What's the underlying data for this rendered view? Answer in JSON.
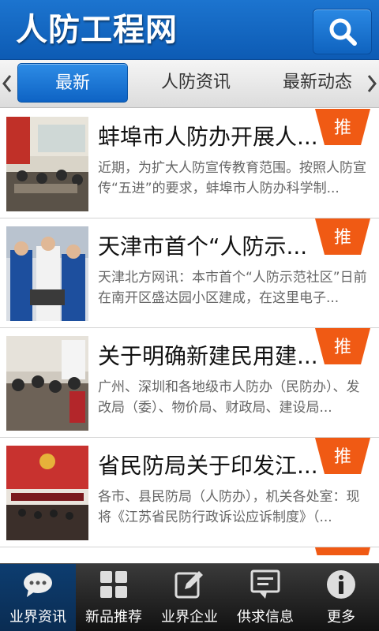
{
  "header": {
    "title": "人防工程网",
    "search_icon": "search-icon"
  },
  "tabs": [
    {
      "label": "最新",
      "active": true
    },
    {
      "label": "人防资讯",
      "active": false
    },
    {
      "label": "最新动态",
      "active": false
    }
  ],
  "news": [
    {
      "title": "蚌埠市人防办开展人...",
      "summary": "近期，为扩大人防宣传教育范围。按照人防宣传“五进”的要求，蚌埠市人防办科学制...",
      "badge": "推"
    },
    {
      "title": "天津市首个“人防示...",
      "summary": "天津北方网讯：本市首个“人防示范社区”日前在南开区盛达园小区建成，在这里电子...",
      "badge": "推"
    },
    {
      "title": "关于明确新建民用建...",
      "summary": "广州、深圳和各地级市人防办（民防办）、发改局（委）、物价局、财政局、建设局...",
      "badge": "推"
    },
    {
      "title": "省民防局关于印发江...",
      "summary": "各市、县民防局（人防办），机关各处室：现将《江苏省民防行政诉讼应诉制度》（...",
      "badge": "推"
    }
  ],
  "bottom_nav": [
    {
      "label": "业界资讯",
      "icon": "chat-bubbles-icon",
      "active": true
    },
    {
      "label": "新品推荐",
      "icon": "grid-icon",
      "active": false
    },
    {
      "label": "业界企业",
      "icon": "edit-icon",
      "active": false
    },
    {
      "label": "供求信息",
      "icon": "message-icon",
      "active": false
    },
    {
      "label": "更多",
      "icon": "info-icon",
      "active": false
    }
  ],
  "colors": {
    "brand_blue": "#0d5bb4",
    "badge_orange": "#f05a14",
    "nav_active": "#0d3d70"
  }
}
